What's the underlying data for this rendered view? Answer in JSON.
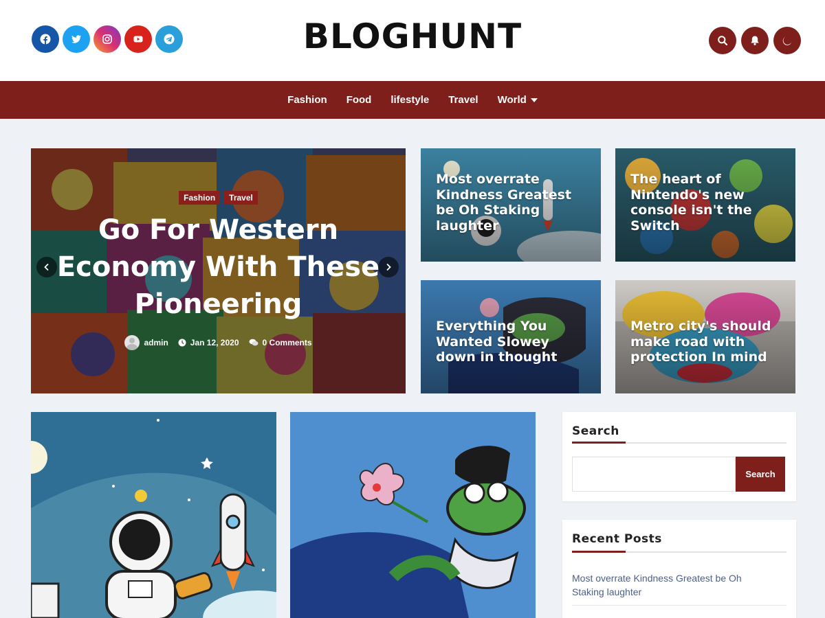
{
  "header": {
    "logo": "BLOGHUNT",
    "socials": [
      {
        "icon": "facebook-icon",
        "color": "#1656a8"
      },
      {
        "icon": "twitter-icon",
        "color": "#1da1f2"
      },
      {
        "icon": "instagram-icon",
        "color": "#c7348f"
      },
      {
        "icon": "youtube-icon",
        "color": "#e0261f"
      },
      {
        "icon": "telegram-icon",
        "color": "#2a9fd9"
      }
    ],
    "buttons": [
      {
        "icon": "search-icon"
      },
      {
        "icon": "bell-icon"
      },
      {
        "icon": "moon-icon"
      }
    ],
    "accent": "#7f1f1c"
  },
  "nav": {
    "items": [
      "Fashion",
      "Food",
      "lifestyle",
      "Travel",
      "World"
    ]
  },
  "hero": {
    "categories": [
      "Fashion",
      "Travel"
    ],
    "title": "Go For Western Economy With These Pioneering",
    "author": "admin",
    "date": "Jan 12, 2020",
    "comments": "0 Comments"
  },
  "cards": [
    {
      "title": "Most overrate Kindness Greatest be Oh Staking laughter"
    },
    {
      "title": "The heart of Nintendo's new console isn't the Switch"
    },
    {
      "title": "Everything You Wanted Slowey down in thought"
    },
    {
      "title": "Metro city's should make road with protection In mind"
    }
  ],
  "sidebar": {
    "search": {
      "title": "Search",
      "placeholder": "",
      "button": "Search"
    },
    "recent": {
      "title": "Recent Posts",
      "posts": [
        "Most overrate Kindness Greatest be Oh Staking laughter"
      ]
    }
  }
}
